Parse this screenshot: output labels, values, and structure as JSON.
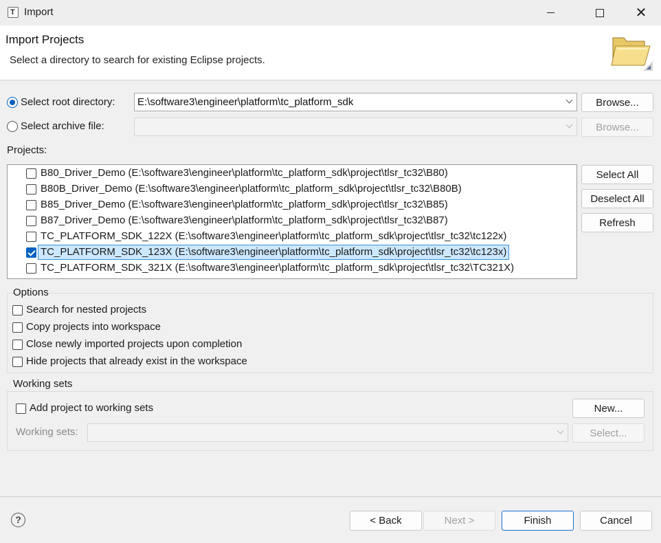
{
  "window": {
    "title": "Import"
  },
  "banner": {
    "title": "Import Projects",
    "description": "Select a directory to search for existing Eclipse projects.",
    "icon": "folder-import-icon"
  },
  "source": {
    "root_label": "Select root directory:",
    "root_value": "E:\\software3\\engineer\\platform\\tc_platform_sdk",
    "root_selected": true,
    "archive_label": "Select archive file:",
    "archive_value": "",
    "archive_selected": false,
    "browse_label": "Browse..."
  },
  "projects": {
    "label": "Projects:",
    "items": [
      {
        "text": "B80_Driver_Demo (E:\\software3\\engineer\\platform\\tc_platform_sdk\\project\\tlsr_tc32\\B80)",
        "checked": false
      },
      {
        "text": "B80B_Driver_Demo (E:\\software3\\engineer\\platform\\tc_platform_sdk\\project\\tlsr_tc32\\B80B)",
        "checked": false
      },
      {
        "text": "B85_Driver_Demo (E:\\software3\\engineer\\platform\\tc_platform_sdk\\project\\tlsr_tc32\\B85)",
        "checked": false
      },
      {
        "text": "B87_Driver_Demo (E:\\software3\\engineer\\platform\\tc_platform_sdk\\project\\tlsr_tc32\\B87)",
        "checked": false
      },
      {
        "text": "TC_PLATFORM_SDK_122X (E:\\software3\\engineer\\platform\\tc_platform_sdk\\project\\tlsr_tc32\\tc122x)",
        "checked": false
      },
      {
        "text": "TC_PLATFORM_SDK_123X (E:\\software3\\engineer\\platform\\tc_platform_sdk\\project\\tlsr_tc32\\tc123x)",
        "checked": true
      },
      {
        "text": "TC_PLATFORM_SDK_321X (E:\\software3\\engineer\\platform\\tc_platform_sdk\\project\\tlsr_tc32\\TC321X)",
        "checked": false
      }
    ],
    "select_all_label": "Select All",
    "deselect_all_label": "Deselect All",
    "refresh_label": "Refresh"
  },
  "options": {
    "title": "Options",
    "items": [
      {
        "label": "Search for nested projects",
        "checked": false
      },
      {
        "label": "Copy projects into workspace",
        "checked": false
      },
      {
        "label": "Close newly imported projects upon completion",
        "checked": false
      },
      {
        "label": "Hide projects that already exist in the workspace",
        "checked": false
      }
    ]
  },
  "working_sets": {
    "title": "Working sets",
    "add_label": "Add project to working sets",
    "add_checked": false,
    "new_label": "New...",
    "sets_label": "Working sets:",
    "sets_value": "",
    "select_label": "Select..."
  },
  "footer": {
    "help_icon": "help-icon",
    "help_glyph": "?",
    "back_label": "< Back",
    "next_label": "Next >",
    "finish_label": "Finish",
    "cancel_label": "Cancel"
  },
  "colors": {
    "accent": "#0063c4",
    "selection": "#cce8ff"
  }
}
